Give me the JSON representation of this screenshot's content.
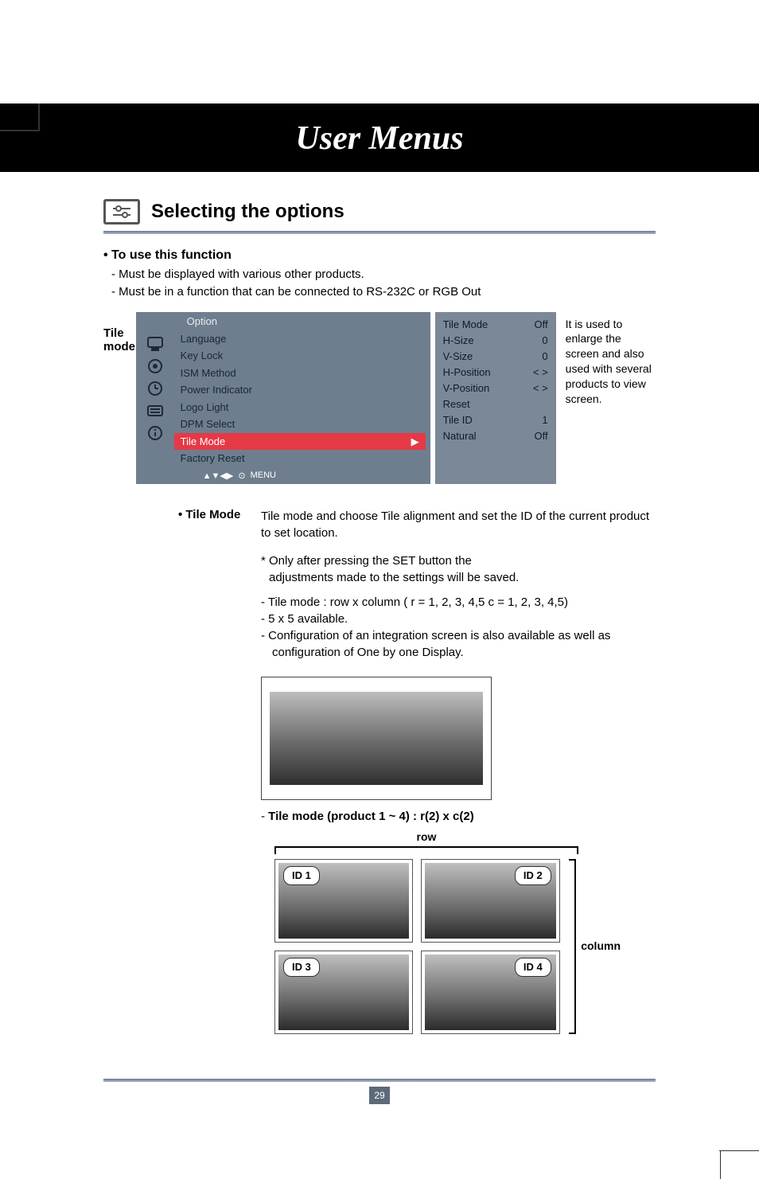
{
  "banner": {
    "title": "User Menus"
  },
  "subheading": "Selecting the options",
  "use_function": {
    "heading": "• To use this function",
    "req1": "- Must be displayed with various other products.",
    "req2": "- Must be in a function that can be connected to RS-232C or RGB Out"
  },
  "tile_mode_label": "Tile mode",
  "side_desc": "It is used to enlarge the screen and also used with several products to view screen.",
  "osd": {
    "header": "Option",
    "items": [
      "Language",
      "Key Lock",
      "ISM Method",
      "Power Indicator",
      "Logo Light",
      "DPM Select",
      "Tile Mode",
      "Factory Reset"
    ],
    "active_index": 6,
    "footer": "MENU"
  },
  "osd_sub": {
    "rows": [
      {
        "label": "Tile Mode",
        "value": "Off"
      },
      {
        "label": "H-Size",
        "value": "0"
      },
      {
        "label": "V-Size",
        "value": "0"
      },
      {
        "label": "H-Position",
        "value": "< >"
      },
      {
        "label": "V-Position",
        "value": "< >"
      },
      {
        "label": "Reset",
        "value": ""
      },
      {
        "label": "Tile ID",
        "value": "1"
      },
      {
        "label": "Natural",
        "value": "Off"
      }
    ]
  },
  "tile_desc": {
    "bullet": "• Tile Mode",
    "p1": "Tile mode and choose Tile alignment and set the ID of the current product to set location.",
    "p2a": "* Only after pressing the SET button the",
    "p2b": "adjustments made to the settings will be saved.",
    "l1": "-  Tile mode : row x column ( r = 1, 2, 3, 4,5   c = 1, 2, 3, 4,5)",
    "l2": "-  5 x 5 available.",
    "l3": "-  Configuration of an integration screen is also available as well as",
    "l3b": "   configuration of One by one Display."
  },
  "formula": {
    "dash": "- ",
    "bold": "Tile mode (product 1 ~ 4) : r(2) x c(2)"
  },
  "grid": {
    "row_label": "row",
    "col_label": "column",
    "ids": [
      "ID 1",
      "ID 2",
      "ID 3",
      "ID 4"
    ]
  },
  "page_num": "29"
}
